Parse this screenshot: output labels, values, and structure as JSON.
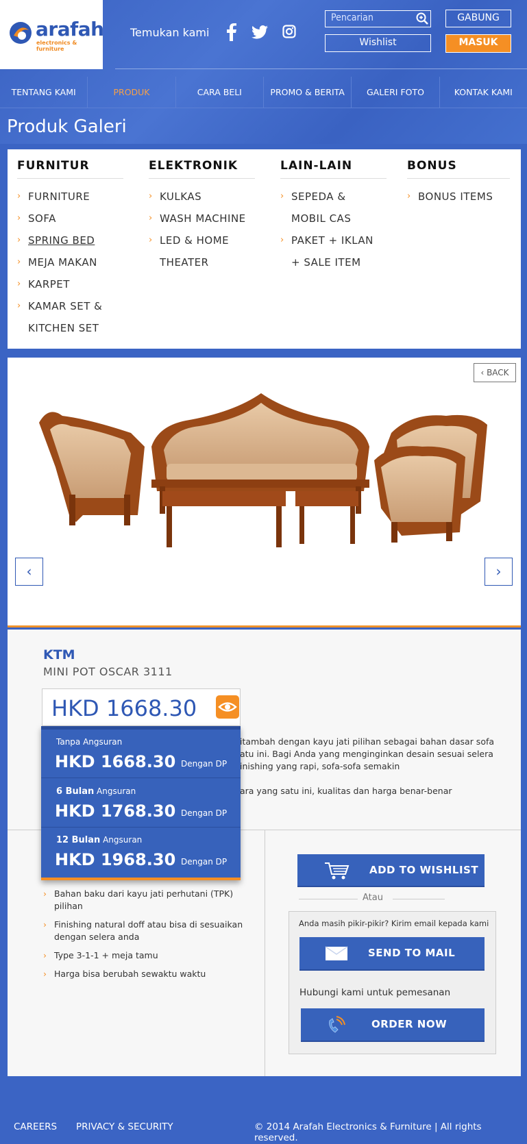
{
  "brand": {
    "name": "arafah",
    "tagline": "electronics & furniture"
  },
  "header": {
    "find_us": "Temukan kami",
    "search_placeholder": "Pencarian",
    "join": "GABUNG",
    "wishlist": "Wishlist",
    "login": "MASUK"
  },
  "nav": {
    "items": [
      {
        "label": "TENTANG KAMI"
      },
      {
        "label": "PRODUK"
      },
      {
        "label": "CARA BELI"
      },
      {
        "label": "PROMO & BERITA"
      },
      {
        "label": "GALERI FOTO"
      },
      {
        "label": "KONTAK KAMI"
      }
    ]
  },
  "page_title": "Produk Galeri",
  "categories": [
    {
      "title": "FURNITUR",
      "items": [
        "FURNITURE",
        "SOFA",
        "SPRING BED",
        "MEJA MAKAN",
        "KARPET",
        "KAMAR SET &",
        "KITCHEN SET"
      ]
    },
    {
      "title": "ELEKTRONIK",
      "items": [
        "KULKAS",
        "WASH MACHINE",
        "LED & HOME",
        "THEATER"
      ]
    },
    {
      "title": "LAIN-LAIN",
      "items": [
        "SEPEDA &",
        "MOBIL CAS",
        "PAKET + IKLAN",
        "+ SALE ITEM"
      ]
    },
    {
      "title": "BONUS",
      "items": [
        "BONUS ITEMS"
      ]
    }
  ],
  "product": {
    "back": "BACK",
    "brand": "KTM",
    "model": "MINI POT OSCAR 3111",
    "price": "HKD 1668.30",
    "description_1": "itambah dengan kayu jati pilihan sebagai bahan dasar sofa",
    "description_2": "atu ini. Bagi Anda yang menginginkan desain sesuai selera",
    "description_3": "inishing yang rapi, sofa-sofa semakin",
    "description_4": "ara yang satu ini, kualitas dan harga benar-benar",
    "features": [
      "Bahan baku dari kayu jati perhutani (TPK) pilihan",
      "Finishing natural doff atau bisa di sesuaikan dengan selera anda",
      "Type 3-1-1 + meja tamu",
      "Harga bisa berubah sewaktu waktu"
    ]
  },
  "installments": [
    {
      "term_bold": "",
      "term": "Tanpa Angsuran",
      "price": "HKD 1668.30",
      "dp": "Dengan DP"
    },
    {
      "term_bold": "6 Bulan",
      "term": "Angsuran",
      "price": "HKD 1768.30",
      "dp": "Dengan DP"
    },
    {
      "term_bold": "12 Bulan",
      "term": "Angsuran",
      "price": "HKD 1968.30",
      "dp": "Dengan DP"
    }
  ],
  "actions": {
    "wishlist": "ADD TO WISHLIST",
    "atau": "Atau",
    "mail_question": "Anda masih pikir-pikir? Kirim email kepada kami",
    "send_mail": "SEND TO MAIL",
    "contact": "Hubungi kami untuk pemesanan",
    "order": "ORDER NOW"
  },
  "footer": {
    "careers": "CAREERS",
    "privacy": "PRIVACY & SECURITY",
    "copyright": "© 2014 Arafah Electronics & Furniture | All rights reserved."
  }
}
